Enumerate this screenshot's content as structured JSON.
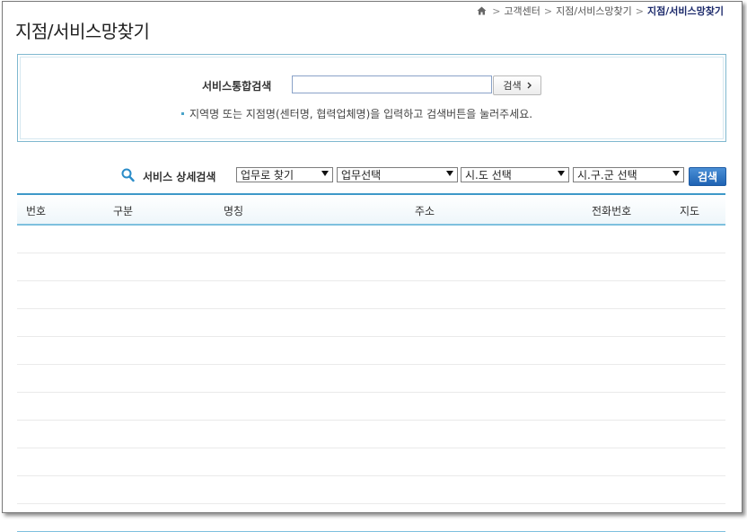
{
  "breadcrumb": {
    "home_icon": "home-icon",
    "items": [
      "고객센터",
      "지점/서비스망찾기"
    ],
    "current": "지점/서비스망찾기"
  },
  "page": {
    "title": "지점/서비스망찾기"
  },
  "integrated_search": {
    "label": "서비스통합검색",
    "input_value": "",
    "button_label": "검색",
    "button_icon": "chevron-right-icon",
    "hint": "지역명 또는 지점명(센터명, 협력업체명)을 입력하고 검색버튼을 눌러주세요."
  },
  "detail_search": {
    "icon": "magnifier-icon",
    "label": "서비스 상세검색",
    "select_mode": "업무로 찾기",
    "select_task": "업무선택",
    "select_city": "시.도 선택",
    "select_district": "시.구.군 선택",
    "button_label": "검색"
  },
  "table": {
    "columns": [
      "번호",
      "구분",
      "명칭",
      "주소",
      "전화번호",
      "지도"
    ],
    "rows": []
  },
  "colors": {
    "accent": "#3e99c8",
    "button_blue": "#1f63b3",
    "title_current": "#1c2a6b"
  }
}
